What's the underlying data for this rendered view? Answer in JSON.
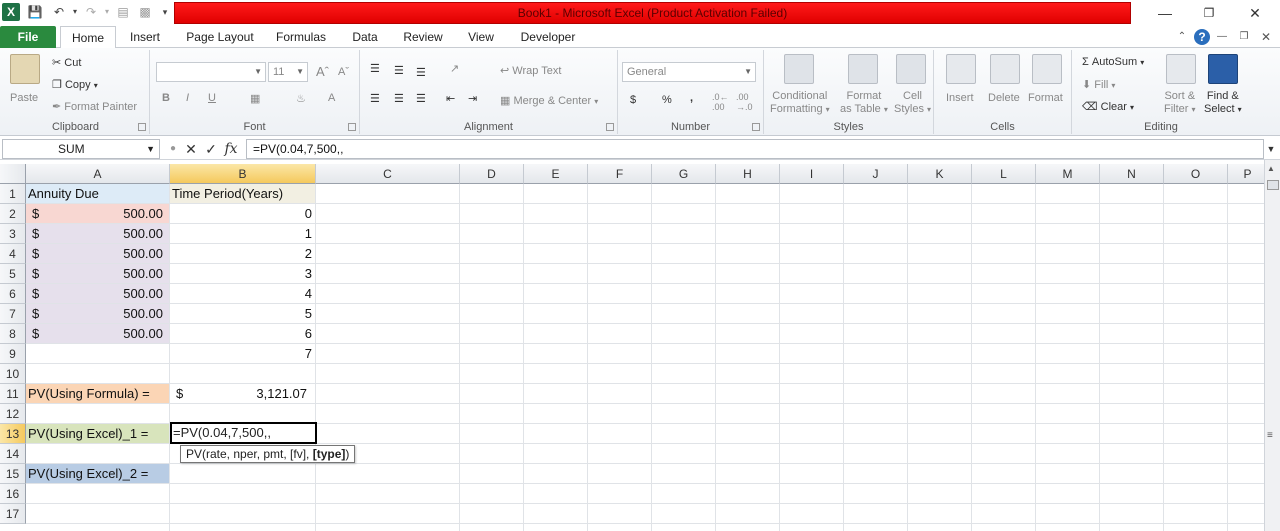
{
  "window": {
    "title": "Book1 - Microsoft Excel (Product Activation Failed)"
  },
  "quick_access": [
    "excel-logo",
    "save-icon",
    "undo-icon",
    "redo-icon"
  ],
  "tabs": [
    {
      "label": "File"
    },
    {
      "label": "Home"
    },
    {
      "label": "Insert"
    },
    {
      "label": "Page Layout"
    },
    {
      "label": "Formulas"
    },
    {
      "label": "Data"
    },
    {
      "label": "Review"
    },
    {
      "label": "View"
    },
    {
      "label": "Developer"
    }
  ],
  "ribbon": {
    "clipboard": {
      "paste": "Paste",
      "cut": "Cut",
      "copy": "Copy",
      "format_painter": "Format Painter",
      "label": "Clipboard"
    },
    "font": {
      "name": "",
      "size": "11",
      "label": "Font"
    },
    "alignment": {
      "wrap_text": "Wrap Text",
      "merge_center": "Merge & Center",
      "label": "Alignment"
    },
    "number": {
      "format": "General",
      "currency": "$",
      "percent": "%",
      "comma": ",",
      "label": "Number"
    },
    "styles": {
      "conditional_1": "Conditional",
      "conditional_2": "Formatting",
      "format_table_1": "Format",
      "format_table_2": "as Table",
      "cell_styles_1": "Cell",
      "cell_styles_2": "Styles",
      "label": "Styles"
    },
    "cells": {
      "insert": "Insert",
      "delete": "Delete",
      "format": "Format",
      "label": "Cells"
    },
    "editing": {
      "autosum": "AutoSum",
      "fill": "Fill",
      "clear": "Clear",
      "sort_1": "Sort &",
      "sort_2": "Filter",
      "find_1": "Find &",
      "find_2": "Select",
      "label": "Editing"
    }
  },
  "formula_bar": {
    "name_box": "SUM",
    "formula": "=PV(0.04,7,500,,"
  },
  "columns": [
    "A",
    "B",
    "C",
    "D",
    "E",
    "F",
    "G",
    "H",
    "I",
    "J",
    "K",
    "L",
    "M",
    "N",
    "O",
    "P"
  ],
  "rows": [
    "1",
    "2",
    "3",
    "4",
    "5",
    "6",
    "7",
    "8",
    "9",
    "10",
    "11",
    "12",
    "13",
    "14",
    "15",
    "16",
    "17"
  ],
  "sheet": {
    "a1": "Annuity Due",
    "b1": "Time Period(Years)",
    "amounts": [
      {
        "cur": "$",
        "val": "500.00"
      },
      {
        "cur": "$",
        "val": "500.00"
      },
      {
        "cur": "$",
        "val": "500.00"
      },
      {
        "cur": "$",
        "val": "500.00"
      },
      {
        "cur": "$",
        "val": "500.00"
      },
      {
        "cur": "$",
        "val": "500.00"
      },
      {
        "cur": "$",
        "val": "500.00"
      }
    ],
    "periods": [
      "0",
      "1",
      "2",
      "3",
      "4",
      "5",
      "6",
      "7"
    ],
    "a11": "PV(Using Formula) =",
    "b11_cur": "$",
    "b11_val": "3,121.07",
    "a13": "PV(Using Excel)_1 =",
    "b13_editing": "=PV(0.04,7,500,,",
    "a15": "PV(Using Excel)_2 ="
  },
  "tooltip": {
    "text": "PV(rate, nper, pmt, [fv], ",
    "bold": "[type]",
    "close": ")"
  },
  "colors": {
    "title_bar": "#e00000",
    "file_tab": "#2a8a3e",
    "a1_fill": "#ddebf7",
    "a2_fill": "#f8d7d2",
    "amount_fill": "#e6e0ec",
    "b1_fill": "#f2efe2",
    "a11_fill": "#fbd5b5",
    "a13_fill": "#d8e4bc",
    "a15_fill": "#b8cce4"
  }
}
